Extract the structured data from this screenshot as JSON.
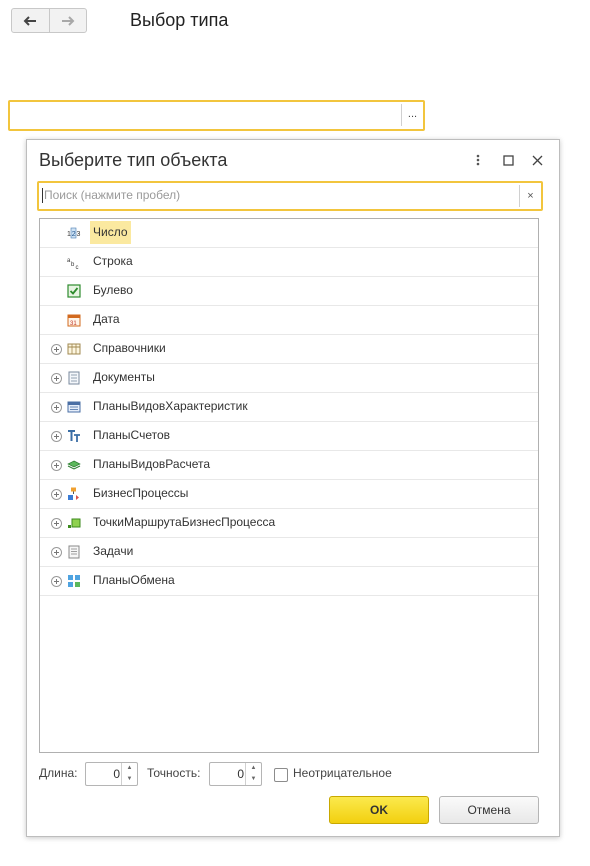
{
  "header": {
    "back_icon": "arrow-left-icon",
    "forward_icon": "arrow-right-icon",
    "title": "Выбор типа"
  },
  "type_field": {
    "value": "",
    "select_button": "..."
  },
  "dialog": {
    "title": "Выберите тип объекта",
    "more_icon": "more-vertical-icon",
    "maximize_icon": "maximize-icon",
    "close_icon": "close-icon",
    "search": {
      "placeholder": "Поиск (нажмите пробел)",
      "clear": "×"
    },
    "items": [
      {
        "label": "Число",
        "icon": "number-icon",
        "expandable": false,
        "selected": true
      },
      {
        "label": "Строка",
        "icon": "string-icon",
        "expandable": false,
        "selected": false
      },
      {
        "label": "Булево",
        "icon": "boolean-icon",
        "expandable": false,
        "selected": false
      },
      {
        "label": "Дата",
        "icon": "calendar-icon",
        "expandable": false,
        "selected": false
      },
      {
        "label": "Справочники",
        "icon": "catalog-icon",
        "expandable": true,
        "selected": false
      },
      {
        "label": "Документы",
        "icon": "document-icon",
        "expandable": true,
        "selected": false
      },
      {
        "label": "ПланыВидовХарактеристик",
        "icon": "chart-of-characteristics-icon",
        "expandable": true,
        "selected": false
      },
      {
        "label": "ПланыСчетов",
        "icon": "chart-of-accounts-icon",
        "expandable": true,
        "selected": false
      },
      {
        "label": "ПланыВидовРасчета",
        "icon": "calculation-types-icon",
        "expandable": true,
        "selected": false
      },
      {
        "label": "БизнесПроцессы",
        "icon": "business-process-icon",
        "expandable": true,
        "selected": false
      },
      {
        "label": "ТочкиМаршрутаБизнесПроцесса",
        "icon": "route-point-icon",
        "expandable": true,
        "selected": false
      },
      {
        "label": "Задачи",
        "icon": "task-icon",
        "expandable": true,
        "selected": false
      },
      {
        "label": "ПланыОбмена",
        "icon": "exchange-plan-icon",
        "expandable": true,
        "selected": false
      }
    ],
    "length_label": "Длина:",
    "length_value": "0",
    "precision_label": "Точность:",
    "precision_value": "0",
    "nonnegative_label": "Неотрицательное",
    "nonnegative_checked": false,
    "ok_label": "OK",
    "cancel_label": "Отмена"
  }
}
